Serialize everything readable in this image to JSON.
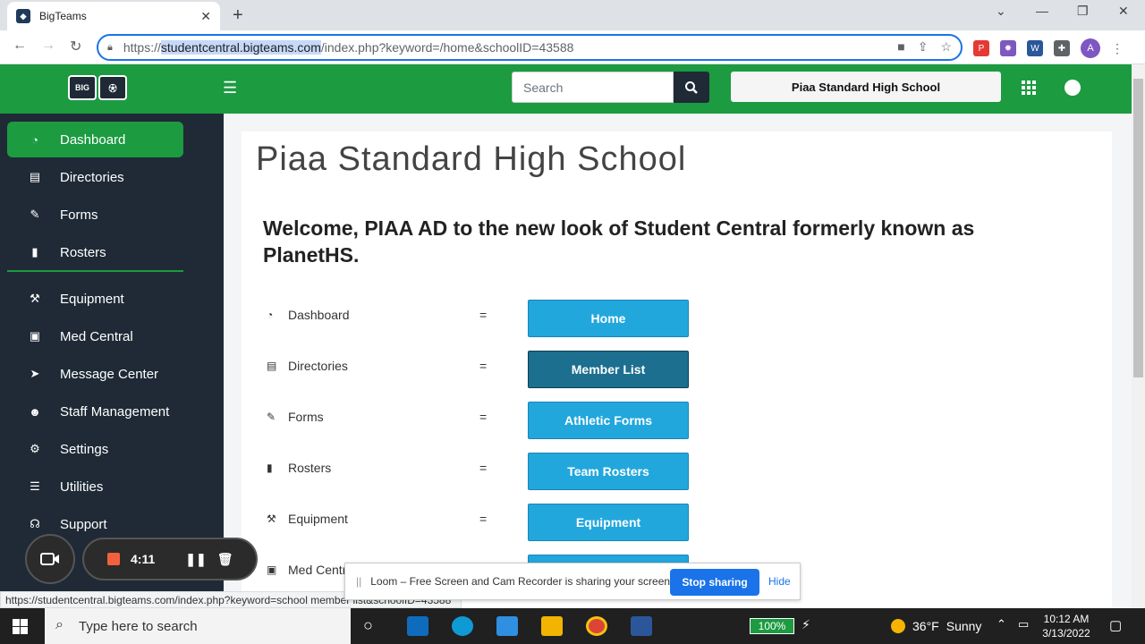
{
  "browser": {
    "tab_title": "BigTeams",
    "url_proto": "https://",
    "url_host": "studentcentral.bigteams.com",
    "url_path": "/index.php?keyword=/home&schoolID=43588",
    "avatar_letter": "A",
    "status_url": "https://studentcentral.bigteams.com/index.php?keyword=school member list&schoolID=43588"
  },
  "header": {
    "logo_text": "BIG",
    "search_placeholder": "Search",
    "school_name": "Piaa Standard High School"
  },
  "sidebar": {
    "items": [
      {
        "label": "Dashboard",
        "icon": "gauge-icon"
      },
      {
        "label": "Directories",
        "icon": "id-card-icon"
      },
      {
        "label": "Forms",
        "icon": "form-edit-icon"
      },
      {
        "label": "Rosters",
        "icon": "clipboard-icon"
      },
      {
        "label": "Equipment",
        "icon": "dumbbell-icon"
      },
      {
        "label": "Med Central",
        "icon": "medical-monitor-icon"
      },
      {
        "label": "Message Center",
        "icon": "paper-plane-icon"
      },
      {
        "label": "Staff Management",
        "icon": "users-icon"
      },
      {
        "label": "Settings",
        "icon": "gear-icon"
      },
      {
        "label": "Utilities",
        "icon": "sliders-icon"
      },
      {
        "label": "Support",
        "icon": "headset-icon"
      }
    ]
  },
  "main": {
    "title": "Piaa Standard High School",
    "welcome": "Welcome, PIAA AD to the new look of Student Central formerly known as PlanetHS.",
    "eq": "=",
    "rows": [
      {
        "label": "Dashboard",
        "button": "Home"
      },
      {
        "label": "Directories",
        "button": "Member List"
      },
      {
        "label": "Forms",
        "button": "Athletic Forms"
      },
      {
        "label": "Rosters",
        "button": "Team Rosters"
      },
      {
        "label": "Equipment",
        "button": "Equipment"
      },
      {
        "label": "Med Central",
        "button": ""
      }
    ]
  },
  "loom": {
    "timer": "4:11",
    "message": "Loom – Free Screen and Cam Recorder is sharing your screen.",
    "stop_label": "Stop sharing",
    "hide_label": "Hide"
  },
  "taskbar": {
    "search_placeholder": "Type here to search",
    "battery": "100%",
    "temperature": "36°F",
    "weather": "Sunny",
    "time": "10:12 AM",
    "date": "3/13/2022"
  },
  "colors": {
    "brand_green": "#1c9b41",
    "sidebar_dark": "#1f2a36",
    "button_blue": "#22a7dd"
  }
}
